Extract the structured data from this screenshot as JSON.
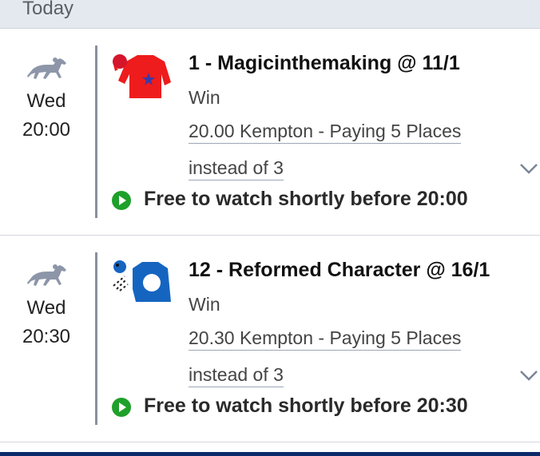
{
  "day_header": {
    "label": "Today"
  },
  "bets": [
    {
      "day": "Wed",
      "time": "20:00",
      "selection": "1 - Magicinthemaking @ 11/1",
      "bet_type": "Win",
      "race_line_1": "20.00 Kempton - Paying 5 Places",
      "race_line_2": "instead of 3",
      "watch": "Free to watch shortly before 20:00",
      "silks": {
        "body": "#ee1c1c",
        "cap": "#d4152a",
        "star": "#3a3aa8"
      }
    },
    {
      "day": "Wed",
      "time": "20:30",
      "selection": "12 - Reformed Character @ 16/1",
      "bet_type": "Win",
      "race_line_1": "20.30 Kempton - Paying 5 Places",
      "race_line_2": "instead of 3",
      "watch": "Free to watch shortly before 20:30",
      "silks": {
        "body": "#1565c0",
        "cap": "#1565c0",
        "inner": "#ffffff"
      }
    }
  ],
  "icons": {
    "horse": "horse-racing-icon",
    "play": "play-circle-icon",
    "chevron": "chevron-down-icon"
  },
  "colors": {
    "play_green": "#1ea02a",
    "horse_grey": "#8d96a8",
    "header_bg": "#e4e8ef"
  }
}
